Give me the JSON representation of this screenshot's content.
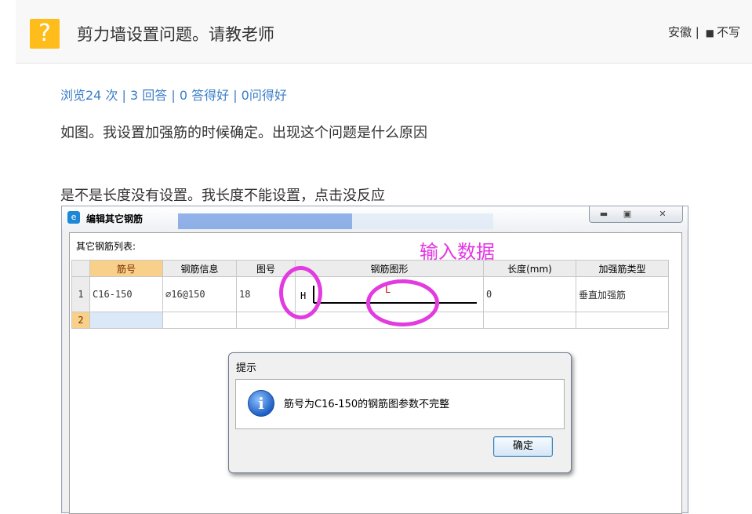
{
  "header": {
    "icon_glyph": "?",
    "title": "剪力墙设置问题。请教老师",
    "location": "安徽",
    "separator": "|",
    "user": "不写"
  },
  "stats": "浏览24 次 | 3 回答 | 0 答得好 | 0问得好",
  "question": {
    "line1": "如图。我设置加强筋的时候确定。出现这个问题是什么原因",
    "line2": "是不是长度没有设置。我长度不能设置，点击没反应"
  },
  "window": {
    "title": "编辑其它钢筋",
    "list_label": "其它钢筋列表:",
    "columns": [
      "筋号",
      "钢筋信息",
      "图号",
      "钢筋图形",
      "长度(mm)",
      "加强筋类型"
    ],
    "rows": [
      {
        "num": "1",
        "bar_no": "C16-150",
        "info": "⌀16@150",
        "fig_no": "18",
        "shape_h": "H",
        "shape_l": "L",
        "length": "0",
        "type": "垂直加强筋"
      },
      {
        "num": "2",
        "bar_no": "",
        "info": "",
        "fig_no": "",
        "shape_h": "",
        "shape_l": "",
        "length": "",
        "type": ""
      }
    ]
  },
  "annotation": "输入数据",
  "dialog": {
    "title": "提示",
    "message": "筋号为C16-150的钢筋图参数不完整",
    "ok": "确定"
  },
  "colors": {
    "accent": "#ffbd1b",
    "link": "#3a7ec8",
    "annotation": "#e23be0"
  }
}
